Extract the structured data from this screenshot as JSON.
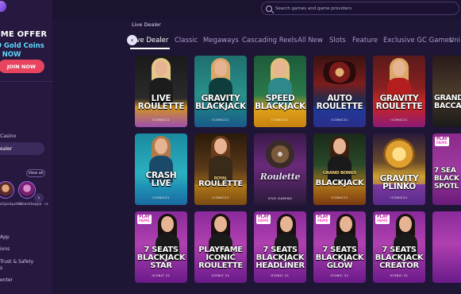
{
  "sidebar": {
    "offer_title": "OME OFFER",
    "offer_line1": "0 Gold Coins",
    "offer_line2": "E NOW",
    "join_label": "JOIN NOW",
    "links": {
      "casino": "Casino",
      "dealer": "ealer",
      "view_all": "View all",
      "app": "App",
      "ions": "ions",
      "trust": "Trust & Safety",
      "trust2": "s",
      "enter": "enter"
    },
    "providers": [
      "uckjackpotte",
      "ilblackhoppa",
      "ra"
    ]
  },
  "topbar": {
    "search_placeholder": "Search games and game providers"
  },
  "breadcrumb": "Live Dealer",
  "tabs": [
    "ive Dealer",
    "Classic",
    "Megaways",
    "Cascading Reels",
    "All New",
    "Slots",
    "Feature",
    "Exclusive GC Games",
    "Uni"
  ],
  "active_tab": 0,
  "cards": [
    {
      "title": "LIVE\nROULETTE",
      "provider": "ICONIC21"
    },
    {
      "title": "GRAVITY\nBLACKJACK",
      "provider": "ICONIC21"
    },
    {
      "title": "SPEED\nBLACKJACK",
      "provider": "ICONIC21"
    },
    {
      "title": "AUTO\nROULETTE",
      "provider": "ICONIC21"
    },
    {
      "title": "GRAVITY\nROULETTE",
      "provider": "ICONIC21"
    },
    {
      "title": "GRAND\nBACCA",
      "provider": ""
    },
    {
      "title": "CRASH\nLIVE",
      "provider": "ICONIC21"
    },
    {
      "title": "ROULETTE",
      "subtitle": "ROYAL",
      "provider": "ICONIC21"
    },
    {
      "title": "Roulette",
      "provider": "VIVO GAMING"
    },
    {
      "title": "BLACKJACK",
      "subtitle": "GRAND BONUS",
      "provider": "ICONIC21"
    },
    {
      "title": "GRAVITY\nPLINKO",
      "provider": "ICONIC21"
    },
    {
      "title": "7 SEA\nBLACK\nSPOTL",
      "provider": ""
    },
    {
      "title": "7 SEATS\nBLACKJACK\nSTAR",
      "provider": "ICONIC 21"
    },
    {
      "title": "PLAYFAME\nICONIC\nROULETTE",
      "provider": "ICONIC 21"
    },
    {
      "title": "7 SEATS\nBLACKJACK\nHEADLINER",
      "provider": "ICONIC 21"
    },
    {
      "title": "7 SEATS\nBLACKJACK\nGLOW",
      "provider": "ICONIC 21"
    },
    {
      "title": "7 SEATS\nBLACKJACK\nCREATOR",
      "provider": "ICONIC 21"
    }
  ],
  "play_badge": {
    "top": "PLAY",
    "bottom": "FAME"
  },
  "colors": {
    "background": "#1f1535",
    "sidebar": "#27183f",
    "join_button": "#e8445f",
    "offer_accent": "#5fd7ff"
  }
}
